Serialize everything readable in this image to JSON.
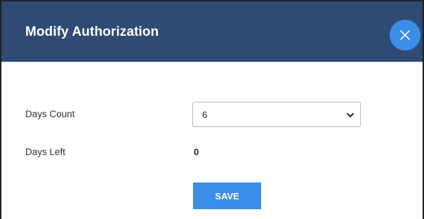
{
  "dialog": {
    "title": "Modify Authorization",
    "close_icon": "close-icon"
  },
  "form": {
    "days_count": {
      "label": "Days Count",
      "selected_value": "6",
      "chevron_icon": "chevron-down-icon"
    },
    "days_left": {
      "label": "Days Left",
      "value": "0"
    },
    "save_label": "SAVE"
  },
  "colors": {
    "header_bg": "#2e4a75",
    "accent": "#3a8ee8",
    "text": "#333333"
  }
}
